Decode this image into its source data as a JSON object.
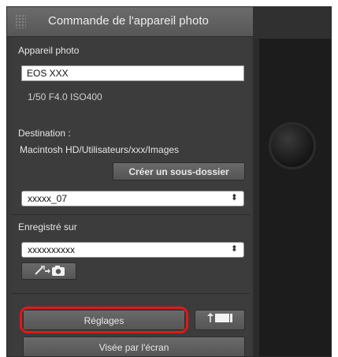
{
  "window": {
    "title": "Commande de l'appareil photo"
  },
  "camera": {
    "section_label": "Appareil photo",
    "model": "EOS XXX",
    "settings": "1/50  F4.0  ISO400"
  },
  "destination": {
    "label": "Destination :",
    "path": "Macintosh HD/Utilisateurs/xxx/Images",
    "create_subfolder_button": "Créer un sous-dossier",
    "folder_select_value": "xxxxx_07"
  },
  "save_to": {
    "label": "Enregistré sur",
    "select_value": "xxxxxxxxxx"
  },
  "buttons": {
    "settings": "Réglages",
    "live_view": "Visée par l'écran"
  },
  "icons": {
    "menu": "dropdown-triangle-icon",
    "transfer": "transfer-to-camera-icon",
    "upload": "upload-to-camera-icon"
  },
  "colors": {
    "highlight": "#e01818",
    "panel_bg": "#3c3c3c"
  }
}
